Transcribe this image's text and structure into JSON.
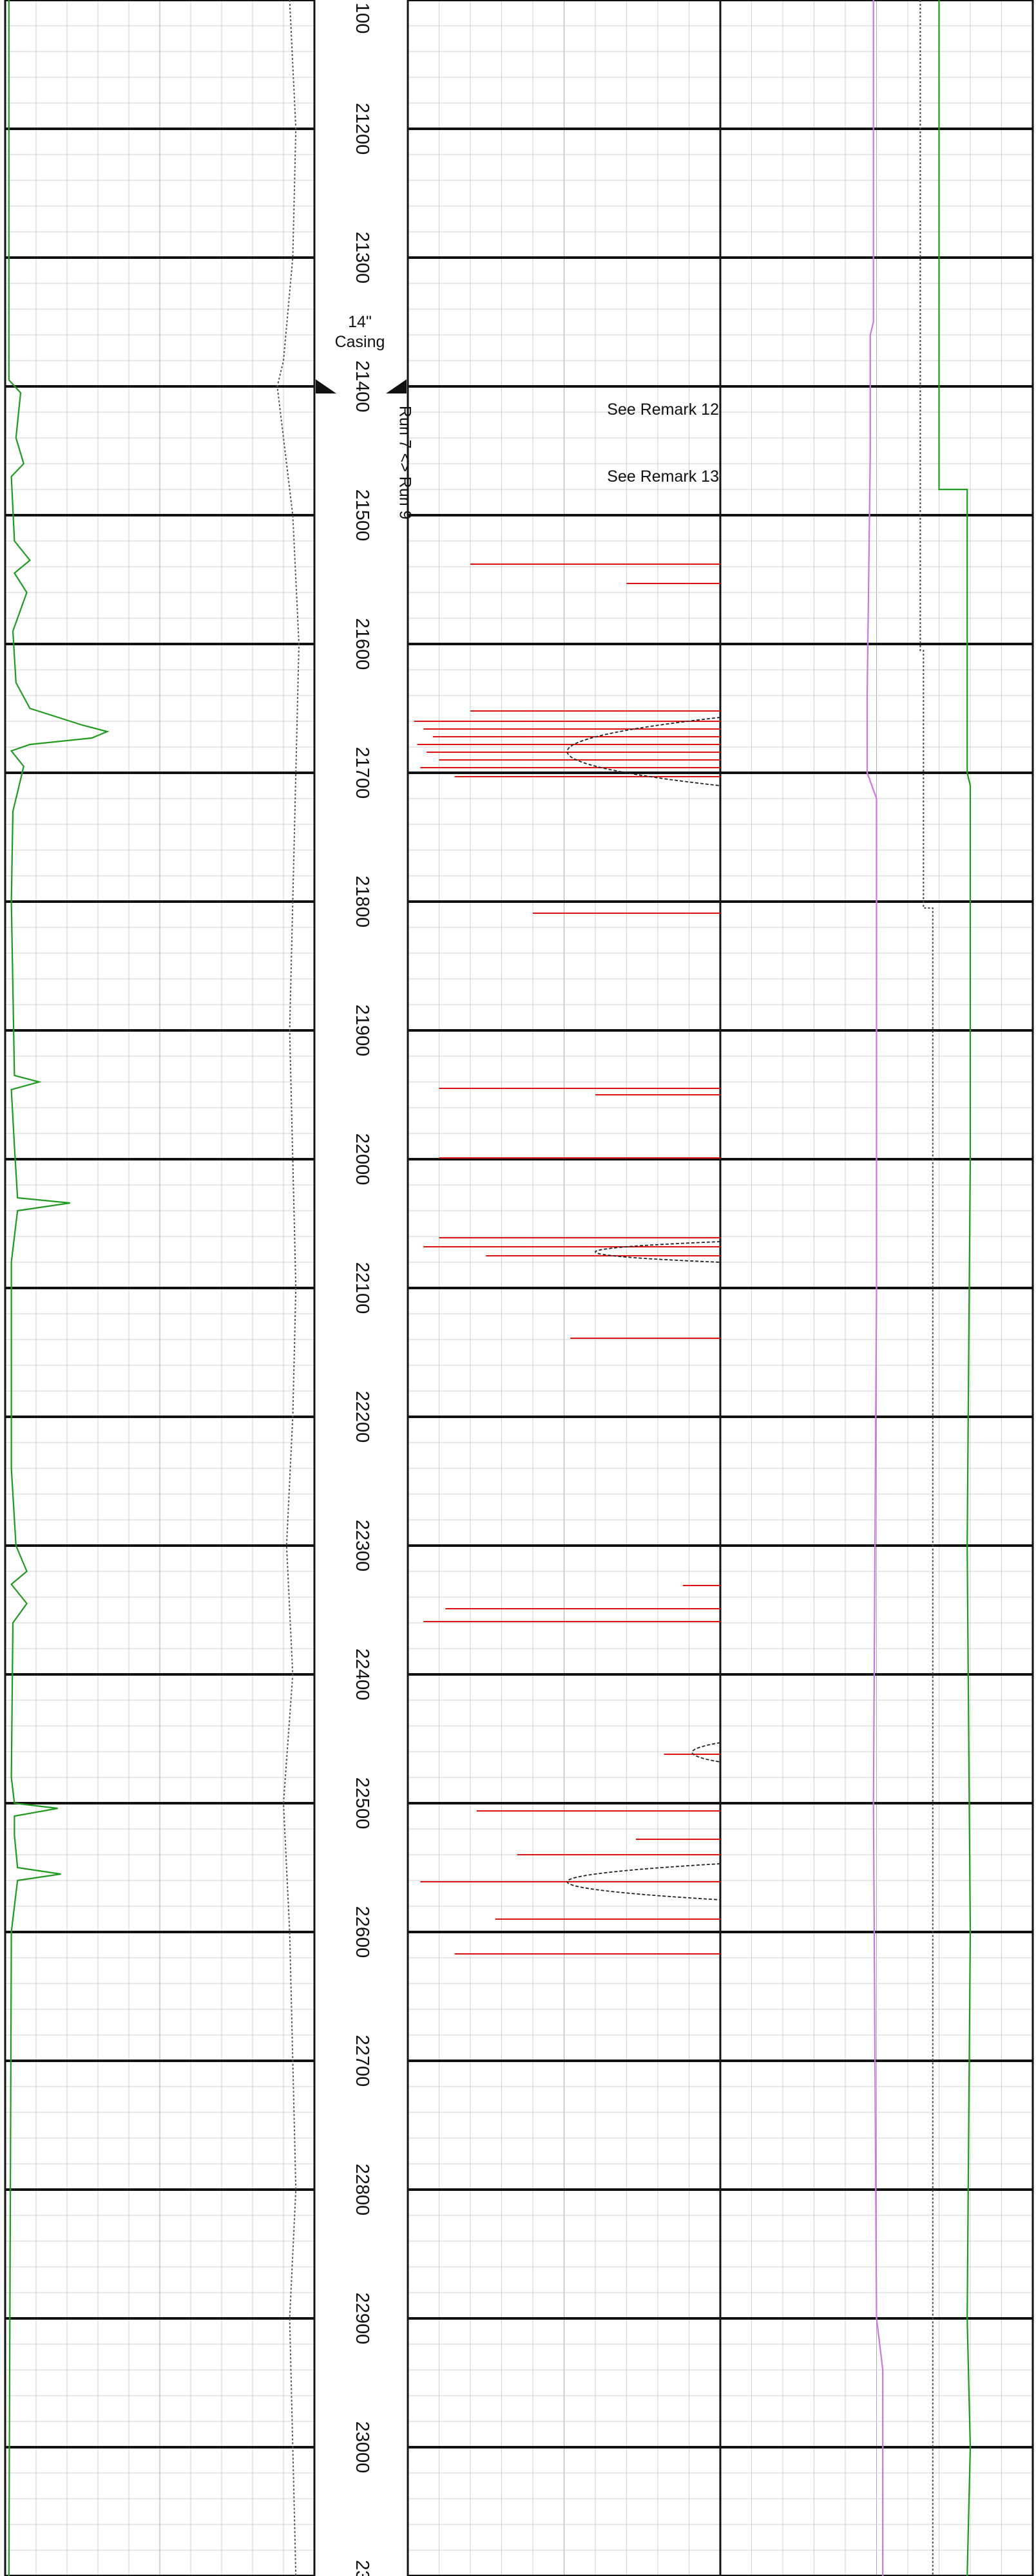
{
  "chart_data": {
    "type": "line",
    "title": "",
    "y_axis": {
      "quantity": "measured depth",
      "range": [
        21100,
        23100
      ],
      "direction": "down",
      "major_step": 100,
      "minor_step": 20,
      "tick_labels": [
        "21200",
        "21300",
        "21400",
        "21500",
        "21600",
        "21700",
        "21800",
        "21900",
        "22000",
        "22100",
        "22200",
        "22300",
        "22400",
        "22500",
        "22600",
        "22700",
        "22800",
        "22900",
        "23000"
      ],
      "partial_top_label": "100",
      "partial_bottom_label": "23"
    },
    "grid": true,
    "annotations": {
      "casing": {
        "lines": [
          "14\"",
          "Casing"
        ],
        "depth": 21400
      },
      "run_change": {
        "text": "Run 7 <> Run 9",
        "depth": 21400
      },
      "remarks": [
        {
          "text": "See Remark 12",
          "depth": 21415
        },
        {
          "text": "See Remark 13",
          "depth": 21467
        }
      ]
    },
    "tracks": [
      {
        "id": "track-1",
        "series": [
          {
            "style": "solid",
            "color": "#1f9a1f",
            "depth": [
              21100,
              21395,
              21405,
              21440,
              21460,
              21470,
              21520,
              21535,
              21545,
              21560,
              21590,
              21630,
              21650,
              21663,
              21668,
              21673,
              21678,
              21683,
              21695,
              21730,
              21800,
              21935,
              21940,
              21946,
              21990,
              22030,
              22034,
              22040,
              22080,
              22240,
              22300,
              22320,
              22330,
              22345,
              22360,
              22480,
              22500,
              22504,
              22510,
              22525,
              22550,
              22555,
              22560,
              22600,
              23100
            ],
            "value": [
              0.012,
              0.012,
              0.05,
              0.035,
              0.06,
              0.02,
              0.03,
              0.08,
              0.03,
              0.07,
              0.025,
              0.035,
              0.08,
              0.25,
              0.33,
              0.28,
              0.08,
              0.02,
              0.06,
              0.025,
              0.02,
              0.03,
              0.11,
              0.02,
              0.03,
              0.04,
              0.21,
              0.04,
              0.02,
              0.02,
              0.035,
              0.07,
              0.02,
              0.07,
              0.025,
              0.02,
              0.03,
              0.17,
              0.03,
              0.03,
              0.04,
              0.18,
              0.04,
              0.02,
              0.012
            ]
          },
          {
            "style": "dotted",
            "color": "#555555",
            "depth": [
              21100,
              21200,
              21300,
              21380,
              21400,
              21500,
              21600,
              21700,
              21800,
              21900,
              22000,
              22100,
              22200,
              22300,
              22400,
              22500,
              22600,
              22700,
              22800,
              22900,
              23000,
              23100
            ],
            "value": [
              0.92,
              0.94,
              0.93,
              0.9,
              0.88,
              0.93,
              0.95,
              0.94,
              0.93,
              0.92,
              0.93,
              0.94,
              0.93,
              0.91,
              0.93,
              0.9,
              0.92,
              0.93,
              0.94,
              0.92,
              0.93,
              0.94
            ]
          }
        ]
      },
      {
        "id": "track-2",
        "spikes": [
          {
            "depth": 21538,
            "value": 0.2
          },
          {
            "depth": 21553,
            "value": 0.7
          },
          {
            "depth": 21652,
            "value": 0.2
          },
          {
            "depth": 21660,
            "value": 0.02
          },
          {
            "depth": 21666,
            "value": 0.05
          },
          {
            "depth": 21672,
            "value": 0.08
          },
          {
            "depth": 21678,
            "value": 0.03
          },
          {
            "depth": 21684,
            "value": 0.06
          },
          {
            "depth": 21690,
            "value": 0.1
          },
          {
            "depth": 21696,
            "value": 0.04
          },
          {
            "depth": 21703,
            "value": 0.15
          },
          {
            "depth": 21809,
            "value": 0.4
          },
          {
            "depth": 21945,
            "value": 0.1
          },
          {
            "depth": 21950,
            "value": 0.6
          },
          {
            "depth": 21999,
            "value": 0.1
          },
          {
            "depth": 22061,
            "value": 0.1
          },
          {
            "depth": 22068,
            "value": 0.05
          },
          {
            "depth": 22075,
            "value": 0.25
          },
          {
            "depth": 22139,
            "value": 0.52
          },
          {
            "depth": 22331,
            "value": 0.88
          },
          {
            "depth": 22349,
            "value": 0.12
          },
          {
            "depth": 22359,
            "value": 0.05
          },
          {
            "depth": 22462,
            "value": 0.82
          },
          {
            "depth": 22506,
            "value": 0.22
          },
          {
            "depth": 22528,
            "value": 0.73
          },
          {
            "depth": 22540,
            "value": 0.35
          },
          {
            "depth": 22561,
            "value": 0.04
          },
          {
            "depth": 22590,
            "value": 0.28
          },
          {
            "depth": 22617,
            "value": 0.15
          }
        ],
        "dashed_envelopes": [
          {
            "top": 21657,
            "bottom": 21710,
            "value": 0.02
          },
          {
            "top": 22064,
            "bottom": 22080,
            "value": 0.2
          },
          {
            "top": 22453,
            "bottom": 22468,
            "value": 0.82
          },
          {
            "top": 22547,
            "bottom": 22575,
            "value": 0.02
          }
        ]
      },
      {
        "id": "track-3",
        "series": [
          {
            "style": "solid",
            "color": "#cc77dd",
            "depth": [
              21100,
              21350,
              21360,
              21450,
              21640,
              21700,
              21720,
              22100,
              22500,
              22900,
              22940,
              23100
            ],
            "value": [
              0.49,
              0.49,
              0.48,
              0.48,
              0.47,
              0.47,
              0.5,
              0.5,
              0.49,
              0.5,
              0.52,
              0.52
            ]
          },
          {
            "style": "dotted",
            "color": "#444444",
            "depth": [
              21100,
              21605,
              21605,
              21805,
              21805,
              22755,
              22755,
              23100
            ],
            "value": [
              0.64,
              0.64,
              0.65,
              0.65,
              0.68,
              0.68,
              0.68,
              0.68
            ]
          },
          {
            "style": "solid",
            "color": "#1f9a1f",
            "depth": [
              21100,
              21480,
              21480,
              21700,
              21710,
              22000,
              22300,
              22600,
              22900,
              23000,
              23100
            ],
            "value": [
              0.7,
              0.7,
              0.79,
              0.79,
              0.8,
              0.8,
              0.79,
              0.8,
              0.79,
              0.8,
              0.79
            ]
          }
        ]
      }
    ]
  }
}
